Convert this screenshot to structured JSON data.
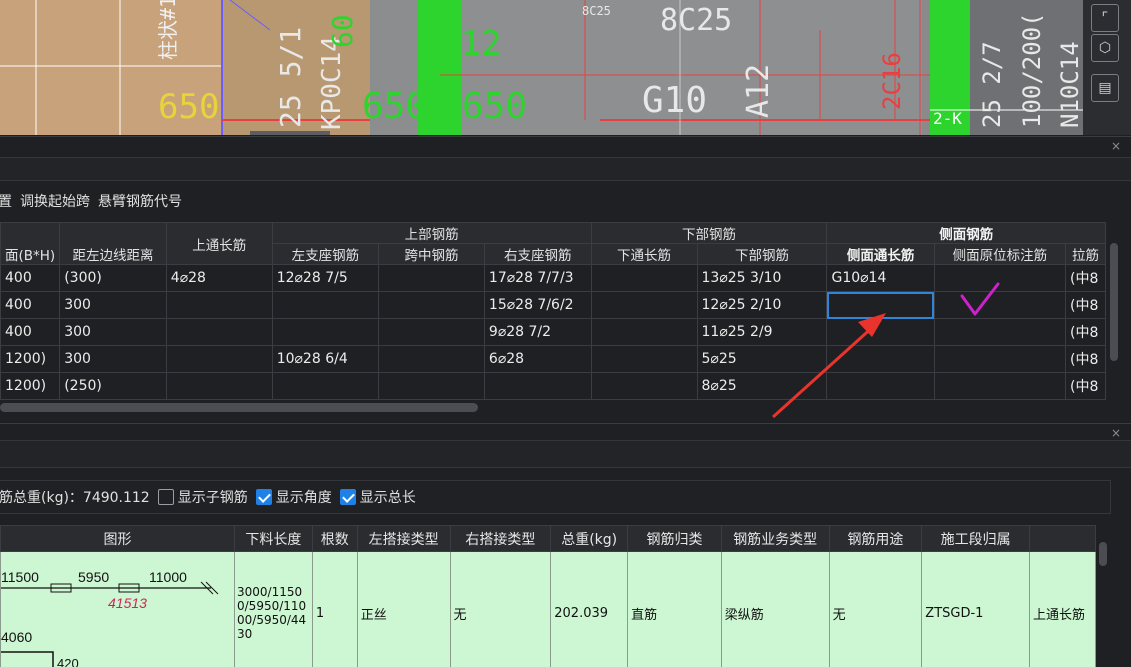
{
  "cad": {
    "labels": {
      "l1": "650",
      "l2": "25 5/1",
      "l3": "C14",
      "l4": "60",
      "l5": "650",
      "l6": "K12",
      "l7": "650",
      "l8": "8C25",
      "l9": "8C25",
      "l10": "G10",
      "l11": "A12",
      "l12": "2C16",
      "l13": "2-K",
      "l14": "25 2/7",
      "l15": "100/200(",
      "l16": "N10C14",
      "l17": "柱状#1",
      "l18": "KP0C14",
      "l19": "C25",
      "l20": "650"
    },
    "tools": [
      "corner-icon",
      "cube-icon",
      "props-icon"
    ]
  },
  "span_panel": {
    "close": "×",
    "toolbar": [
      "置",
      "调换起始跨",
      "悬臂钢筋代号"
    ],
    "groups": {
      "top": "上部钢筋",
      "bottom": "下部钢筋",
      "side": "侧面钢筋"
    },
    "headers": {
      "size": "面(B*H)",
      "dist": "距左边线距离",
      "through": "上通长筋",
      "left_sup": "左支座钢筋",
      "mid": "跨中钢筋",
      "right_sup": "右支座钢筋",
      "bot_through": "下通长筋",
      "bot": "下部钢筋",
      "side_through": "侧面通长筋",
      "side_orig": "侧面原位标注筋",
      "tie": "拉筋"
    },
    "rows": [
      {
        "size": "400",
        "dist": "(300)",
        "through": "4⌀28",
        "left_sup": "12⌀28 7/5",
        "mid": "",
        "right_sup": "17⌀28 7/7/3",
        "bot_through": "",
        "bot": "13⌀25 3/10",
        "side_through": "G10⌀14",
        "side_orig": "",
        "tie": "(中8"
      },
      {
        "size": "400",
        "dist": "300",
        "through": "",
        "left_sup": "",
        "mid": "",
        "right_sup": "15⌀28 7/6/2",
        "bot_through": "",
        "bot": "12⌀25 2/10",
        "side_through": "",
        "side_orig": "",
        "tie": "(中8"
      },
      {
        "size": "400",
        "dist": "300",
        "through": "",
        "left_sup": "",
        "mid": "",
        "right_sup": "9⌀28 7/2",
        "bot_through": "",
        "bot": "11⌀25 2/9",
        "side_through": "",
        "side_orig": "",
        "tie": "(中8"
      },
      {
        "size": "1200)",
        "dist": "300",
        "through": "",
        "left_sup": "10⌀28 6/4",
        "mid": "",
        "right_sup": "6⌀28",
        "bot_through": "",
        "bot": "5⌀25",
        "side_through": "",
        "side_orig": "",
        "tie": "(中8"
      },
      {
        "size": "1200)",
        "dist": "(250)",
        "through": "",
        "left_sup": "",
        "mid": "",
        "right_sup": "",
        "bot_through": "",
        "bot": "8⌀25",
        "side_through": "",
        "side_orig": "",
        "tie": "(中8"
      }
    ]
  },
  "rebar_panel": {
    "close": "×",
    "total_label": "筋总重(kg)：7490.112",
    "checks": [
      {
        "label": "显示子钢筋",
        "checked": false
      },
      {
        "label": "显示角度",
        "checked": true
      },
      {
        "label": "显示总长",
        "checked": true
      }
    ],
    "headers": [
      "图形",
      "下料长度",
      "根数",
      "左搭接类型",
      "右搭接类型",
      "总重(kg)",
      "钢筋归类",
      "钢筋业务类型",
      "钢筋用途",
      "施工段归属",
      ""
    ],
    "row": {
      "length": "3000/11500/5950/11000/5950/4430",
      "count": "1",
      "left_lap": "正丝",
      "right_lap": "无",
      "weight": "202.039",
      "category": "直筋",
      "biz_type": "梁纵筋",
      "usage": "无",
      "segment": "ZTSGD-1",
      "extra": "上通长筋"
    },
    "shape": {
      "d1": "11500",
      "d2": "5950",
      "d3": "11000",
      "total": "41513",
      "d4": "4060",
      "d5": "420"
    }
  },
  "colors": {
    "accent": "#1f80e6",
    "green_row": "#cdf7d2",
    "annotation": "#e8342c",
    "checkmark": "#cc22cc"
  }
}
